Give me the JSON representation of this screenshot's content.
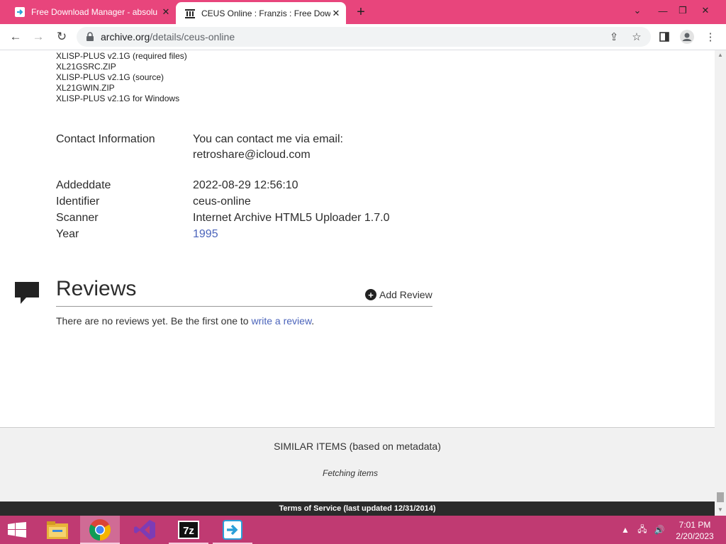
{
  "browser": {
    "tabs": [
      {
        "title": "Free Download Manager - absolu",
        "active": false
      },
      {
        "title": "CEUS Online : Franzis : Free Dow",
        "active": true
      }
    ],
    "new_tab_label": "+",
    "url_host": "archive.org",
    "url_path": "/details/ceus-online"
  },
  "page": {
    "files": [
      "XLISP-PLUS v2.1G (required files)",
      "XL21GSRC.ZIP",
      "XLISP-PLUS v2.1G (source)",
      "XL21GWIN.ZIP",
      "XLISP-PLUS v2.1G for Windows"
    ],
    "contact": {
      "label": "Contact Information",
      "line1": "You can contact me via email:",
      "line2": "retroshare@icloud.com"
    },
    "metadata": [
      {
        "key": "Addeddate",
        "value": "2022-08-29 12:56:10"
      },
      {
        "key": "Identifier",
        "value": "ceus-online"
      },
      {
        "key": "Scanner",
        "value": "Internet Archive HTML5 Uploader 1.7.0"
      },
      {
        "key": "Year",
        "value": "1995"
      }
    ],
    "reviews": {
      "title": "Reviews",
      "add_label": "Add Review",
      "empty_text": "There are no reviews yet. Be the first one to ",
      "empty_link": "write a review",
      "empty_end": "."
    },
    "similar": {
      "heading": "SIMILAR ITEMS (based on metadata)",
      "status": "Fetching items"
    },
    "tos": "Terms of Service (last updated 12/31/2014)"
  },
  "taskbar": {
    "apps": [
      "file-explorer",
      "chrome",
      "visual-studio",
      "7zip",
      "free-download-manager"
    ],
    "time": "7:01 PM",
    "date": "2/20/2023"
  },
  "colors": {
    "tabstrip": "#e8457c",
    "taskbar": "#c03a72",
    "link": "#4b64bb"
  }
}
